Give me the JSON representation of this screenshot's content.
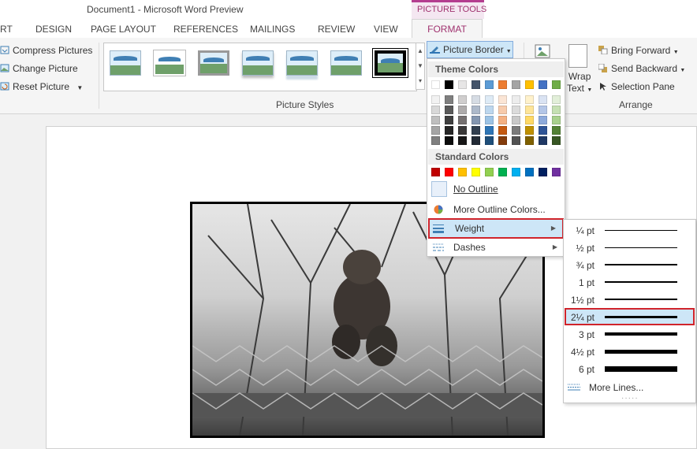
{
  "app": {
    "title": "Document1 - Microsoft Word Preview",
    "context_group": "PICTURE TOOLS"
  },
  "tabs": [
    "RT",
    "DESIGN",
    "PAGE LAYOUT",
    "REFERENCES",
    "MAILINGS",
    "REVIEW",
    "VIEW",
    "FORMAT"
  ],
  "adjust": {
    "compress": "Compress Pictures",
    "change": "Change Picture",
    "reset": "Reset Picture"
  },
  "picture_styles": {
    "group_label": "Picture Styles"
  },
  "picture_border": {
    "label": "Picture Border"
  },
  "wrap_text": {
    "line1": "Wrap",
    "line2": "Text"
  },
  "arrange": {
    "bring_forward": "Bring Forward",
    "send_backward": "Send Backward",
    "selection_pane": "Selection Pane",
    "group_label": "Arrange"
  },
  "border_menu": {
    "theme_colors_label": "Theme Colors",
    "standard_colors_label": "Standard Colors",
    "no_outline": "No Outline",
    "more_colors": "More Outline Colors...",
    "weight": "Weight",
    "dashes": "Dashes",
    "theme_colors": [
      "#ffffff",
      "#000000",
      "#e7e6e6",
      "#44546a",
      "#5b9bd5",
      "#ed7d31",
      "#a5a5a5",
      "#ffc000",
      "#4472c4",
      "#70ad47"
    ],
    "theme_shades": [
      [
        "#f2f2f2",
        "#7f7f7f",
        "#d0cece",
        "#d6dce4",
        "#deebf6",
        "#fbe5d5",
        "#ededed",
        "#fff2cc",
        "#dae3f3",
        "#e2efd9"
      ],
      [
        "#d8d8d8",
        "#595959",
        "#aeabab",
        "#adb9ca",
        "#bdd7ee",
        "#f7cbac",
        "#dbdbdb",
        "#fee599",
        "#b4c6e7",
        "#c5e0b3"
      ],
      [
        "#bfbfbf",
        "#3f3f3f",
        "#757070",
        "#8496b0",
        "#9cc3e5",
        "#f4b183",
        "#c9c9c9",
        "#ffd965",
        "#8eaadb",
        "#a8d08d"
      ],
      [
        "#a5a5a5",
        "#262626",
        "#3a3838",
        "#323f4f",
        "#2e75b5",
        "#c55a11",
        "#7b7b7b",
        "#bf9000",
        "#2f5496",
        "#538135"
      ],
      [
        "#7f7f7f",
        "#0c0c0c",
        "#171616",
        "#222a35",
        "#1e4e79",
        "#833c0b",
        "#525252",
        "#7f6000",
        "#1f3864",
        "#375623"
      ]
    ],
    "standard_colors": [
      "#c00000",
      "#ff0000",
      "#ffc000",
      "#ffff00",
      "#92d050",
      "#00b050",
      "#00b0f0",
      "#0070c0",
      "#002060",
      "#7030a0"
    ]
  },
  "weight_menu": {
    "items": [
      {
        "label": "¼ pt",
        "selected": false
      },
      {
        "label": "½ pt",
        "selected": false
      },
      {
        "label": "¾ pt",
        "selected": false
      },
      {
        "label": "1 pt",
        "selected": false
      },
      {
        "label": "1½ pt",
        "selected": false
      },
      {
        "label": "2¼ pt",
        "selected": true
      },
      {
        "label": "3 pt",
        "selected": false
      },
      {
        "label": "4½ pt",
        "selected": false
      },
      {
        "label": "6 pt",
        "selected": false
      }
    ],
    "more_lines": "More Lines..."
  },
  "colors": {
    "accent": "#a0326f",
    "highlight": "#cde6f7",
    "annotation": "#d0242b"
  }
}
